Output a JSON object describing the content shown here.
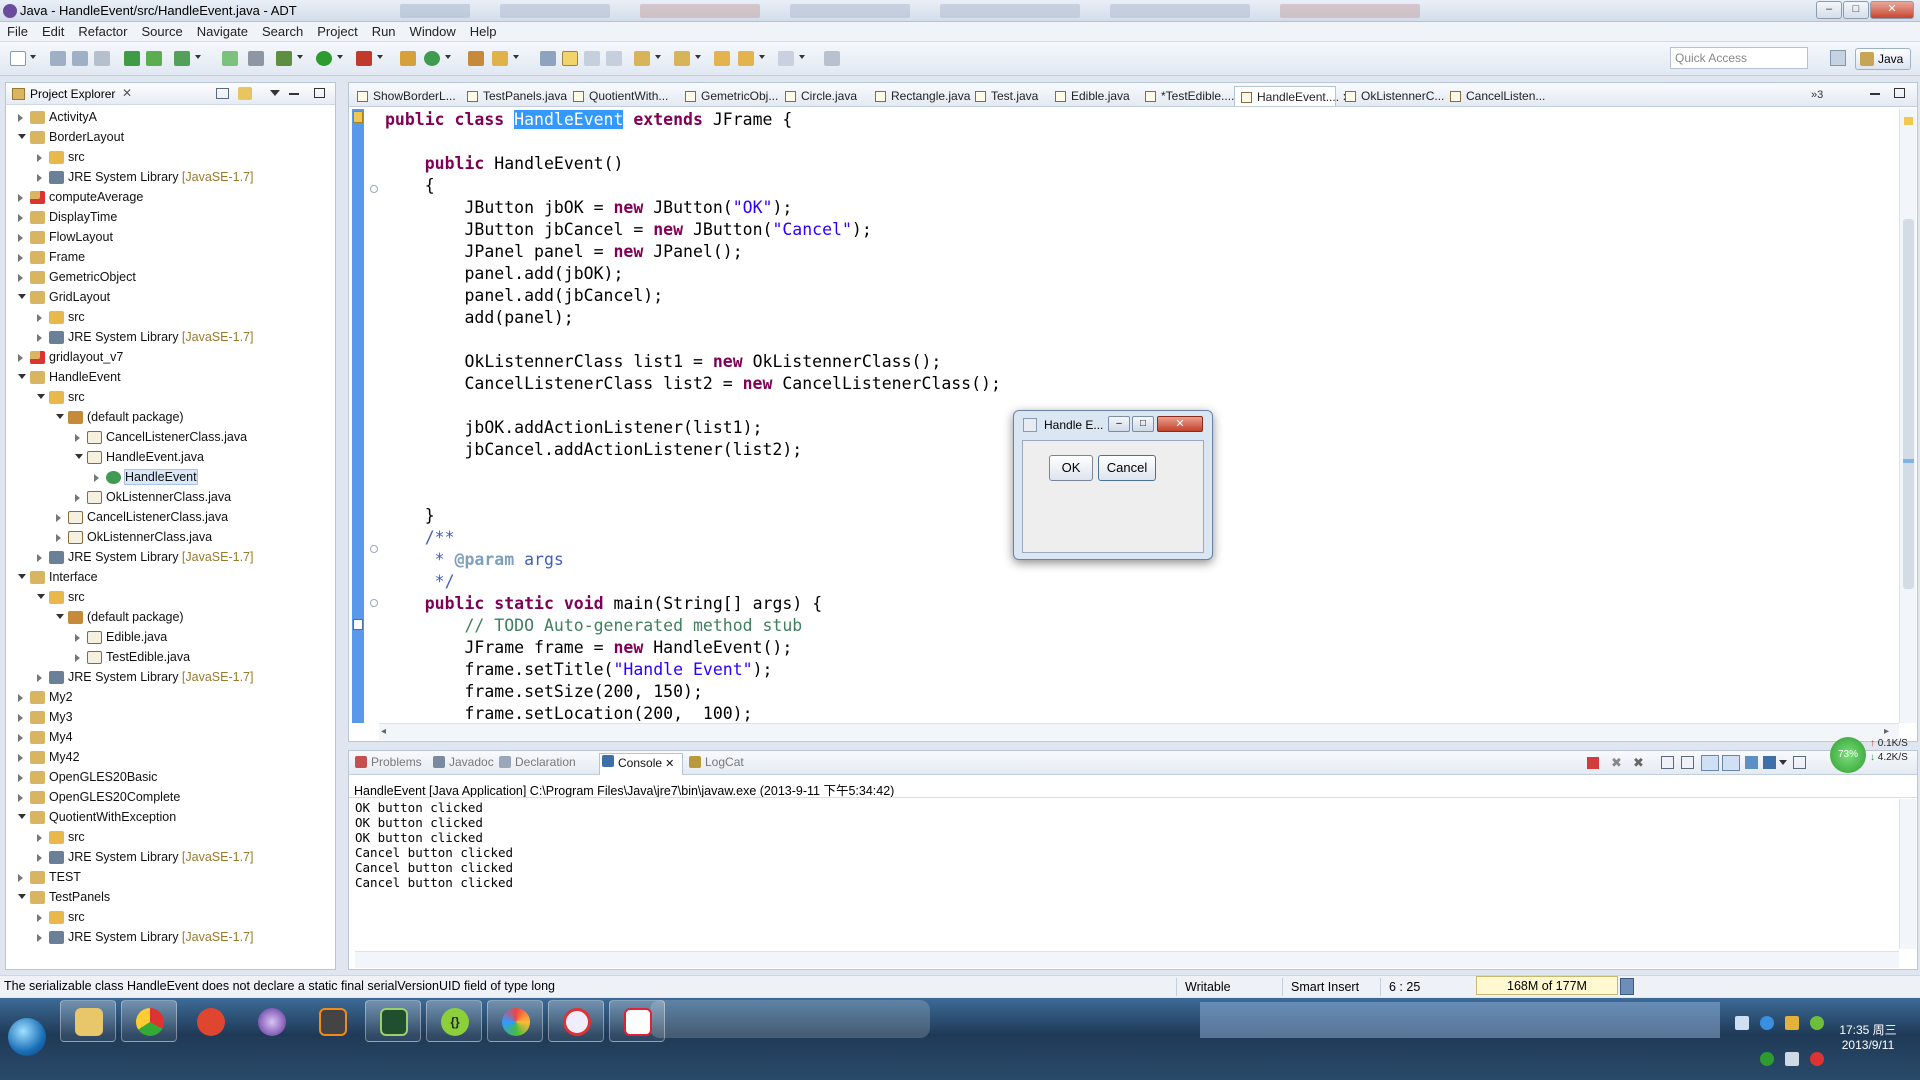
{
  "window": {
    "title": "Java - HandleEvent/src/HandleEvent.java - ADT",
    "min": "–",
    "max": "□",
    "close": "✕"
  },
  "menubar": {
    "items": [
      "File",
      "Edit",
      "Refactor",
      "Source",
      "Navigate",
      "Search",
      "Project",
      "Run",
      "Window",
      "Help"
    ]
  },
  "toolbar": {
    "quick_access_placeholder": "Quick Access",
    "perspective": "Java"
  },
  "explorer": {
    "title": "Project Explorer",
    "rows": [
      {
        "label": "ActivityA",
        "suffix": "",
        "depth": 0,
        "arrow": "c",
        "icon": "project"
      },
      {
        "label": "BorderLayout",
        "suffix": "",
        "depth": 0,
        "arrow": "e",
        "icon": "project"
      },
      {
        "label": "src",
        "suffix": "",
        "depth": 1,
        "arrow": "c",
        "icon": "folder"
      },
      {
        "label": "JRE System Library ",
        "suffix": "[JavaSE-1.7]",
        "depth": 1,
        "arrow": "c",
        "icon": "library"
      },
      {
        "label": "computeAverage",
        "suffix": "",
        "depth": 0,
        "arrow": "c",
        "icon": "project-error"
      },
      {
        "label": "DisplayTime",
        "suffix": "",
        "depth": 0,
        "arrow": "c",
        "icon": "project"
      },
      {
        "label": "FlowLayout",
        "suffix": "",
        "depth": 0,
        "arrow": "c",
        "icon": "project"
      },
      {
        "label": "Frame",
        "suffix": "",
        "depth": 0,
        "arrow": "c",
        "icon": "project"
      },
      {
        "label": "GemetricObject",
        "suffix": "",
        "depth": 0,
        "arrow": "c",
        "icon": "project"
      },
      {
        "label": "GridLayout",
        "suffix": "",
        "depth": 0,
        "arrow": "e",
        "icon": "project"
      },
      {
        "label": "src",
        "suffix": "",
        "depth": 1,
        "arrow": "c",
        "icon": "folder"
      },
      {
        "label": "JRE System Library ",
        "suffix": "[JavaSE-1.7]",
        "depth": 1,
        "arrow": "c",
        "icon": "library"
      },
      {
        "label": "gridlayout_v7",
        "suffix": "",
        "depth": 0,
        "arrow": "c",
        "icon": "project-error"
      },
      {
        "label": "HandleEvent",
        "suffix": "",
        "depth": 0,
        "arrow": "e",
        "icon": "project"
      },
      {
        "label": "src",
        "suffix": "",
        "depth": 1,
        "arrow": "e",
        "icon": "folder"
      },
      {
        "label": "(default package)",
        "suffix": "",
        "depth": 2,
        "arrow": "e",
        "icon": "package"
      },
      {
        "label": "CancelListenerClass.java",
        "suffix": "",
        "depth": 3,
        "arrow": "c",
        "icon": "java"
      },
      {
        "label": "HandleEvent.java",
        "suffix": "",
        "depth": 3,
        "arrow": "e",
        "icon": "java"
      },
      {
        "label": "HandleEvent",
        "suffix": "",
        "depth": 4,
        "arrow": "c",
        "icon": "class",
        "selected": true
      },
      {
        "label": "OkListennerClass.java",
        "suffix": "",
        "depth": 3,
        "arrow": "c",
        "icon": "java"
      },
      {
        "label": "CancelListenerClass.java",
        "suffix": "",
        "depth": 2,
        "arrow": "c",
        "icon": "java"
      },
      {
        "label": "OkListennerClass.java",
        "suffix": "",
        "depth": 2,
        "arrow": "c",
        "icon": "java"
      },
      {
        "label": "JRE System Library ",
        "suffix": "[JavaSE-1.7]",
        "depth": 1,
        "arrow": "c",
        "icon": "library"
      },
      {
        "label": "Interface",
        "suffix": "",
        "depth": 0,
        "arrow": "e",
        "icon": "project"
      },
      {
        "label": "src",
        "suffix": "",
        "depth": 1,
        "arrow": "e",
        "icon": "folder"
      },
      {
        "label": "(default package)",
        "suffix": "",
        "depth": 2,
        "arrow": "e",
        "icon": "package"
      },
      {
        "label": "Edible.java",
        "suffix": "",
        "depth": 3,
        "arrow": "c",
        "icon": "java"
      },
      {
        "label": "TestEdible.java",
        "suffix": "",
        "depth": 3,
        "arrow": "c",
        "icon": "java"
      },
      {
        "label": "JRE System Library ",
        "suffix": "[JavaSE-1.7]",
        "depth": 1,
        "arrow": "c",
        "icon": "library"
      },
      {
        "label": "My2",
        "suffix": "",
        "depth": 0,
        "arrow": "c",
        "icon": "project"
      },
      {
        "label": "My3",
        "suffix": "",
        "depth": 0,
        "arrow": "c",
        "icon": "project"
      },
      {
        "label": "My4",
        "suffix": "",
        "depth": 0,
        "arrow": "c",
        "icon": "project"
      },
      {
        "label": "My42",
        "suffix": "",
        "depth": 0,
        "arrow": "c",
        "icon": "project"
      },
      {
        "label": "OpenGLES20Basic",
        "suffix": "",
        "depth": 0,
        "arrow": "c",
        "icon": "project"
      },
      {
        "label": "OpenGLES20Complete",
        "suffix": "",
        "depth": 0,
        "arrow": "c",
        "icon": "project"
      },
      {
        "label": "QuotientWithException",
        "suffix": "",
        "depth": 0,
        "arrow": "e",
        "icon": "project"
      },
      {
        "label": "src",
        "suffix": "",
        "depth": 1,
        "arrow": "c",
        "icon": "folder"
      },
      {
        "label": "JRE System Library ",
        "suffix": "[JavaSE-1.7]",
        "depth": 1,
        "arrow": "c",
        "icon": "library"
      },
      {
        "label": "TEST",
        "suffix": "",
        "depth": 0,
        "arrow": "c",
        "icon": "project"
      },
      {
        "label": "TestPanels",
        "suffix": "",
        "depth": 0,
        "arrow": "e",
        "icon": "project"
      },
      {
        "label": "src",
        "suffix": "",
        "depth": 1,
        "arrow": "c",
        "icon": "folder"
      },
      {
        "label": "JRE System Library ",
        "suffix": "[JavaSE-1.7]",
        "depth": 1,
        "arrow": "c",
        "icon": "library"
      }
    ]
  },
  "editor": {
    "tabs": [
      {
        "label": "ShowBorderL...",
        "active": false
      },
      {
        "label": "TestPanels.java",
        "active": false
      },
      {
        "label": "QuotientWith...",
        "active": false
      },
      {
        "label": "GemetricObj...",
        "active": false
      },
      {
        "label": "Circle.java",
        "active": false
      },
      {
        "label": "Rectangle.java",
        "active": false
      },
      {
        "label": "Test.java",
        "active": false
      },
      {
        "label": "Edible.java",
        "active": false
      },
      {
        "label": "*TestEdible....",
        "active": false
      },
      {
        "label": "HandleEvent....",
        "active": true
      },
      {
        "label": "OkListennerC...",
        "active": false
      },
      {
        "label": "CancelListen...",
        "active": false
      }
    ],
    "overflow": "»3",
    "code": [
      [
        [
          "kw",
          "public"
        ],
        [
          "t",
          " "
        ],
        [
          "kw",
          "class"
        ],
        [
          "t",
          " "
        ],
        [
          "sel",
          "HandleEvent"
        ],
        [
          "t",
          " "
        ],
        [
          "kw",
          "extends"
        ],
        [
          "t",
          " JFrame {"
        ]
      ],
      [],
      [
        [
          "t",
          "    "
        ],
        [
          "kw",
          "public"
        ],
        [
          "t",
          " HandleEvent()"
        ]
      ],
      [
        [
          "t",
          "    {"
        ]
      ],
      [
        [
          "t",
          "        JButton jbOK = "
        ],
        [
          "kw",
          "new"
        ],
        [
          "t",
          " JButton("
        ],
        [
          "str",
          "\"OK\""
        ],
        [
          "t",
          ");"
        ]
      ],
      [
        [
          "t",
          "        JButton jbCancel = "
        ],
        [
          "kw",
          "new"
        ],
        [
          "t",
          " JButton("
        ],
        [
          "str",
          "\"Cancel\""
        ],
        [
          "t",
          ");"
        ]
      ],
      [
        [
          "t",
          "        JPanel panel = "
        ],
        [
          "kw",
          "new"
        ],
        [
          "t",
          " JPanel();"
        ]
      ],
      [
        [
          "t",
          "        panel.add(jbOK);"
        ]
      ],
      [
        [
          "t",
          "        panel.add(jbCancel);"
        ]
      ],
      [
        [
          "t",
          "        add(panel);"
        ]
      ],
      [],
      [
        [
          "t",
          "        OkListennerClass list1 = "
        ],
        [
          "kw",
          "new"
        ],
        [
          "t",
          " OkListennerClass();"
        ]
      ],
      [
        [
          "t",
          "        CancelListenerClass list2 = "
        ],
        [
          "kw",
          "new"
        ],
        [
          "t",
          " CancelListenerClass();"
        ]
      ],
      [],
      [
        [
          "t",
          "        jbOK.addActionListener(list1);"
        ]
      ],
      [
        [
          "t",
          "        jbCancel.addActionListener(list2);"
        ]
      ],
      [],
      [],
      [
        [
          "t",
          "    }"
        ]
      ],
      [
        [
          "t",
          "    "
        ],
        [
          "jd",
          "/**"
        ]
      ],
      [
        [
          "t",
          "     "
        ],
        [
          "jd",
          "* "
        ],
        [
          "jdtag",
          "@param"
        ],
        [
          "jd",
          " args"
        ]
      ],
      [
        [
          "t",
          "     "
        ],
        [
          "jd",
          "*/"
        ]
      ],
      [
        [
          "t",
          "    "
        ],
        [
          "kw",
          "public"
        ],
        [
          "t",
          " "
        ],
        [
          "kw",
          "static"
        ],
        [
          "t",
          " "
        ],
        [
          "kw",
          "void"
        ],
        [
          "t",
          " main(String[] args) {"
        ]
      ],
      [
        [
          "t",
          "        "
        ],
        [
          "cm",
          "// TODO Auto-generated method stub"
        ]
      ],
      [
        [
          "t",
          "        JFrame frame = "
        ],
        [
          "kw",
          "new"
        ],
        [
          "t",
          " HandleEvent();"
        ]
      ],
      [
        [
          "t",
          "        frame.setTitle("
        ],
        [
          "str",
          "\"Handle Event\""
        ],
        [
          "t",
          ");"
        ]
      ],
      [
        [
          "t",
          "        frame.setSize(200, 150);"
        ]
      ],
      [
        [
          "t",
          "        frame.setLocation(200,  100);"
        ]
      ]
    ]
  },
  "dialog": {
    "title": "Handle E...",
    "ok": "OK",
    "cancel": "Cancel"
  },
  "console": {
    "tabs": [
      {
        "label": "Problems",
        "active": false,
        "icon": "problems"
      },
      {
        "label": "Javadoc",
        "active": false,
        "icon": "javadoc"
      },
      {
        "label": "Declaration",
        "active": false,
        "icon": "declaration"
      },
      {
        "label": "Console",
        "active": true,
        "icon": "console"
      },
      {
        "label": "LogCat",
        "active": false,
        "icon": "logcat"
      }
    ],
    "description": "HandleEvent [Java Application] C:\\Program Files\\Java\\jre7\\bin\\javaw.exe (2013-9-11 下午5:34:42)",
    "output": [
      "OK button clicked",
      "OK button clicked",
      "OK button clicked",
      "Cancel button clicked",
      "Cancel button clicked",
      "Cancel button clicked"
    ]
  },
  "status": {
    "message": "The serializable class HandleEvent does not declare a static final serialVersionUID field of type long",
    "writable": "Writable",
    "insert_mode": "Smart Insert",
    "position": "6 : 25",
    "heap": "168M of 177M"
  },
  "network": {
    "gauge": "73%",
    "up": "0.1K/S",
    "down": "4.2K/S"
  },
  "taskbar": {
    "time": "17:35 周三",
    "date": "2013/9/11",
    "apps": [
      "explorer",
      "chrome",
      "app-red",
      "eclipse",
      "sublime",
      "terminal",
      "json-editor",
      "paint",
      "search",
      "java"
    ]
  },
  "colors": {
    "keyword": "#7f0055",
    "string": "#2a00ff",
    "comment": "#3f7f5f",
    "javadoc": "#3f5fbf",
    "selection": "#3399ff",
    "ruler": "#5a98ea"
  }
}
